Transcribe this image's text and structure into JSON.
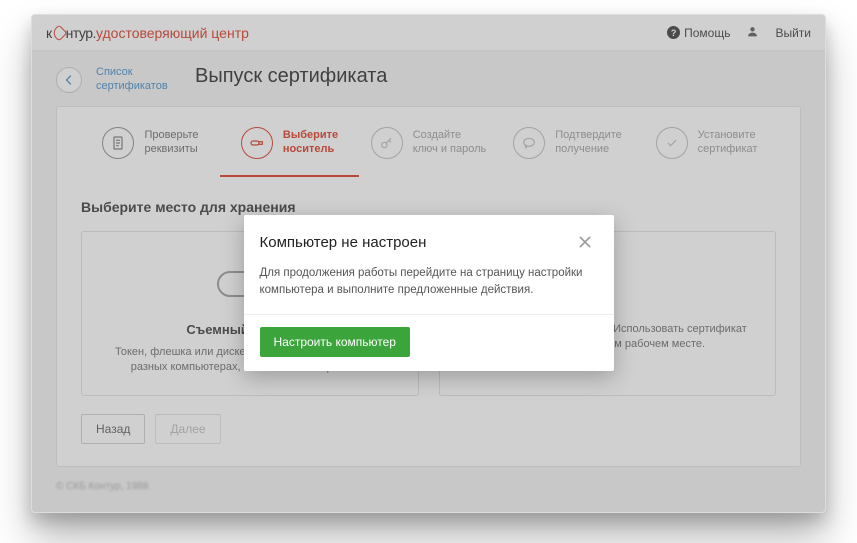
{
  "brand": {
    "prefix": "к",
    "mid": "нтур.",
    "suffix": "удостоверяющий центр"
  },
  "topbar": {
    "help": "Помощь",
    "exit": "Выйти"
  },
  "breadcrumb": {
    "back_link": "Список сертификатов"
  },
  "page_title": "Выпуск сертификата",
  "stepper": {
    "s1": {
      "l1": "Проверьте",
      "l2": "реквизиты"
    },
    "s2": {
      "l1": "Выберите",
      "l2": "носитель"
    },
    "s3": {
      "l1": "Создайте",
      "l2": "ключ и пароль"
    },
    "s4": {
      "l1": "Подтвердите",
      "l2": "получение"
    },
    "s5": {
      "l1": "Установите",
      "l2": "сертификат"
    }
  },
  "section_title": "Выберите место для хранения",
  "options": {
    "o1": {
      "title": "Съемный носитель",
      "desc": "Токен, флешка или дискета. Можно использовать на разных компьютерах, если носитель при себе."
    },
    "o2": {
      "title": "",
      "desc": "Хранилище на компьютере. Использовать сертификат можно только на этом рабочем месте."
    }
  },
  "nav": {
    "back": "Назад",
    "next": "Далее"
  },
  "footer": "© СКБ Контур, 1988",
  "modal": {
    "title": "Компьютер не настроен",
    "body": "Для продолжения работы перейдите на страницу настройки компьютера и выполните предложенные действия.",
    "cta": "Настроить компьютер"
  }
}
